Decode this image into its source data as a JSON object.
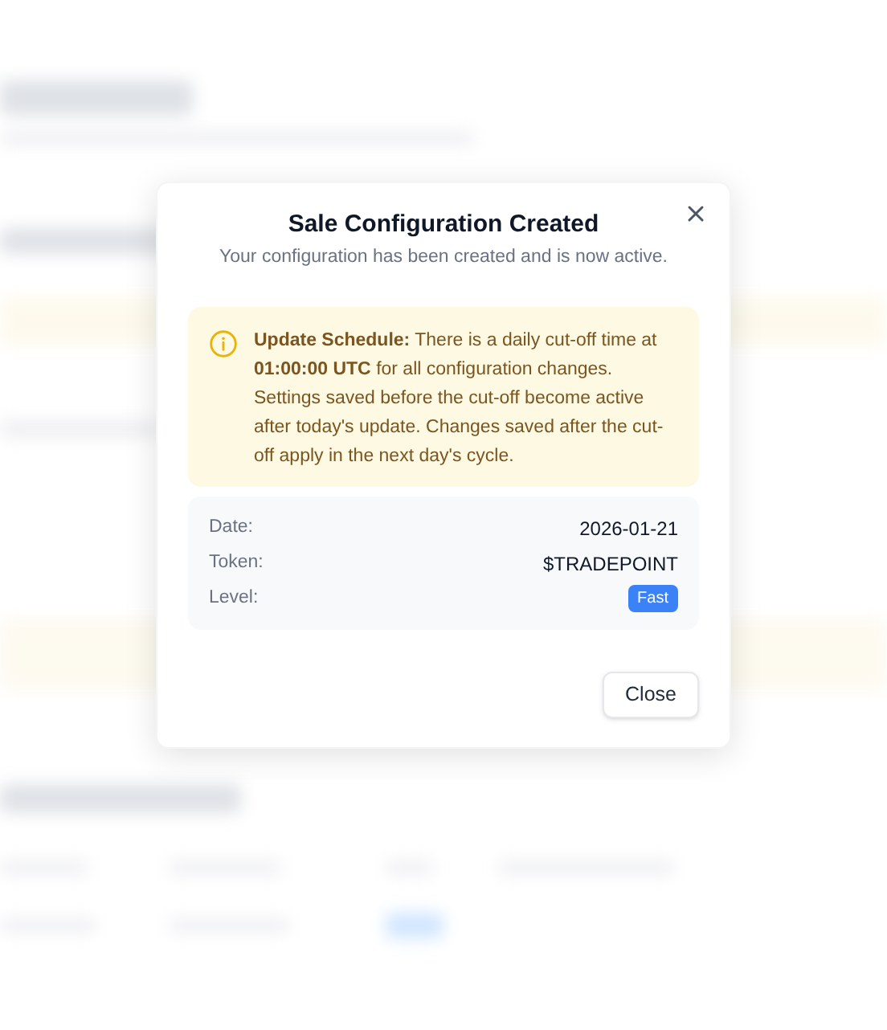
{
  "dialog": {
    "title": "Sale Configuration Created",
    "subtitle": "Your configuration has been created and is now active.",
    "notice": {
      "text": "**Update Schedule:** There is a daily cut-off time at **01:00:00 UTC** for all configuration changes. Settings saved before the cut-off become active after today's update. Changes saved after the cut-off apply in the next day's cycle."
    },
    "details": [
      {
        "label": "Date:",
        "value": "2026-01-21",
        "kind": "text"
      },
      {
        "label": "Token:",
        "value": "$TRADEPOINT",
        "kind": "text"
      },
      {
        "label": "Level:",
        "value": "Fast",
        "kind": "badge"
      }
    ],
    "buttons": [
      "Close"
    ]
  }
}
